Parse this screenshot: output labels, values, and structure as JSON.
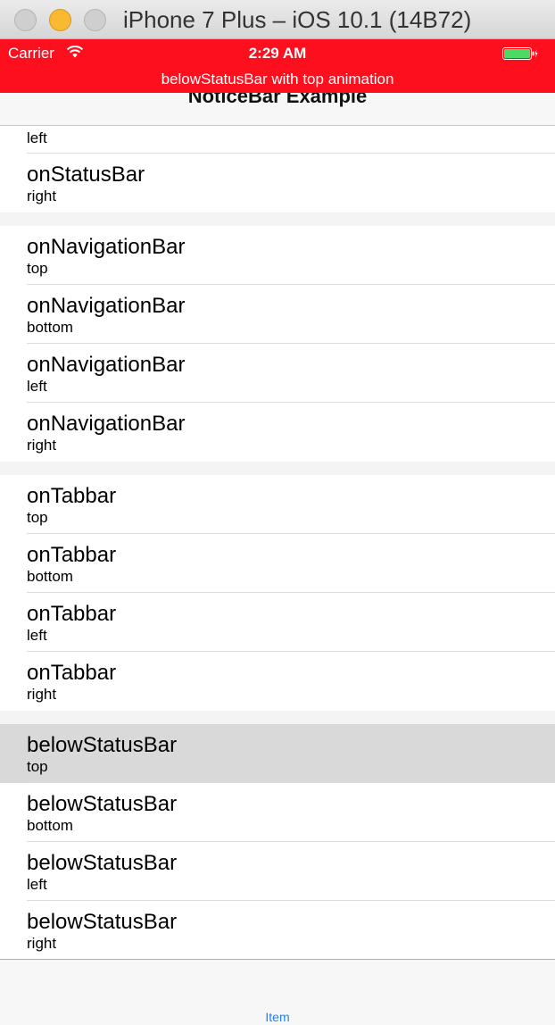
{
  "window": {
    "title": "iPhone 7 Plus – iOS 10.1 (14B72)"
  },
  "status_bar": {
    "carrier": "Carrier",
    "time": "2:29 AM",
    "wifi_icon": "wifi-icon",
    "battery_icon": "battery-charging-icon",
    "background_color": "#fd0f1d"
  },
  "notice": {
    "message": "belowStatusBar with top animation"
  },
  "nav": {
    "title": "NoticeBar Example"
  },
  "sections": [
    {
      "rows": [
        {
          "subtitle": "left",
          "partial": true
        },
        {
          "title": "onStatusBar",
          "subtitle": "right"
        }
      ]
    },
    {
      "rows": [
        {
          "title": "onNavigationBar",
          "subtitle": "top"
        },
        {
          "title": "onNavigationBar",
          "subtitle": "bottom"
        },
        {
          "title": "onNavigationBar",
          "subtitle": "left"
        },
        {
          "title": "onNavigationBar",
          "subtitle": "right"
        }
      ]
    },
    {
      "rows": [
        {
          "title": "onTabbar",
          "subtitle": "top"
        },
        {
          "title": "onTabbar",
          "subtitle": "bottom"
        },
        {
          "title": "onTabbar",
          "subtitle": "left"
        },
        {
          "title": "onTabbar",
          "subtitle": "right"
        }
      ]
    },
    {
      "rows": [
        {
          "title": "belowStatusBar",
          "subtitle": "top",
          "selected": true
        },
        {
          "title": "belowStatusBar",
          "subtitle": "bottom"
        },
        {
          "title": "belowStatusBar",
          "subtitle": "left"
        },
        {
          "title": "belowStatusBar",
          "subtitle": "right"
        }
      ]
    }
  ],
  "tabbar": {
    "item_label": "Item",
    "accent_color": "#1a82fb"
  }
}
